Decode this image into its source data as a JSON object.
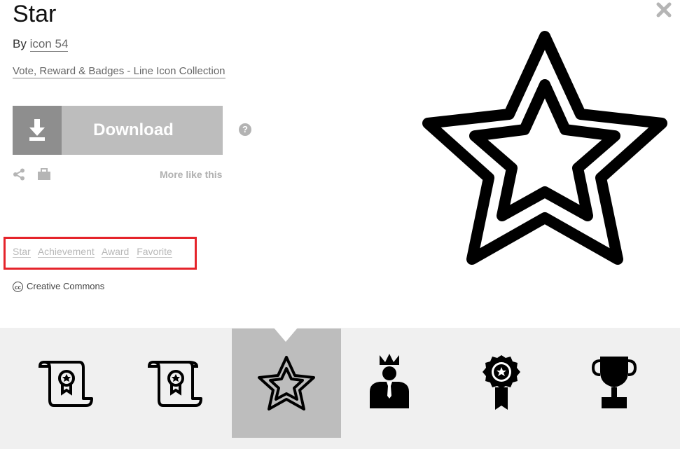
{
  "icon": {
    "title": "Star",
    "by_prefix": "By",
    "author": "icon 54",
    "collection": "Vote, Reward & Badges - Line Icon Collection"
  },
  "actions": {
    "download_label": "Download",
    "help_glyph": "?",
    "more_like_this": "More like this"
  },
  "tags": [
    "Star",
    "Achievement",
    "Award",
    "Favorite"
  ],
  "license": {
    "cc_glyph": "cc",
    "label": "Creative Commons"
  },
  "colors": {
    "download_bg": "#bdbdbd",
    "download_icon_bg": "#8e8e8e",
    "highlight_border": "#e5242b",
    "strip_bg": "#f0f0f0",
    "selected_thumb_bg": "#bdbdbd"
  },
  "thumbnails": [
    {
      "name": "certificate-scroll-icon",
      "selected": false
    },
    {
      "name": "certificate-scroll-icon",
      "selected": false
    },
    {
      "name": "star-icon",
      "selected": true
    },
    {
      "name": "king-crown-person-icon",
      "selected": false
    },
    {
      "name": "award-badge-ribbon-icon",
      "selected": false
    },
    {
      "name": "trophy-icon",
      "selected": false
    }
  ]
}
